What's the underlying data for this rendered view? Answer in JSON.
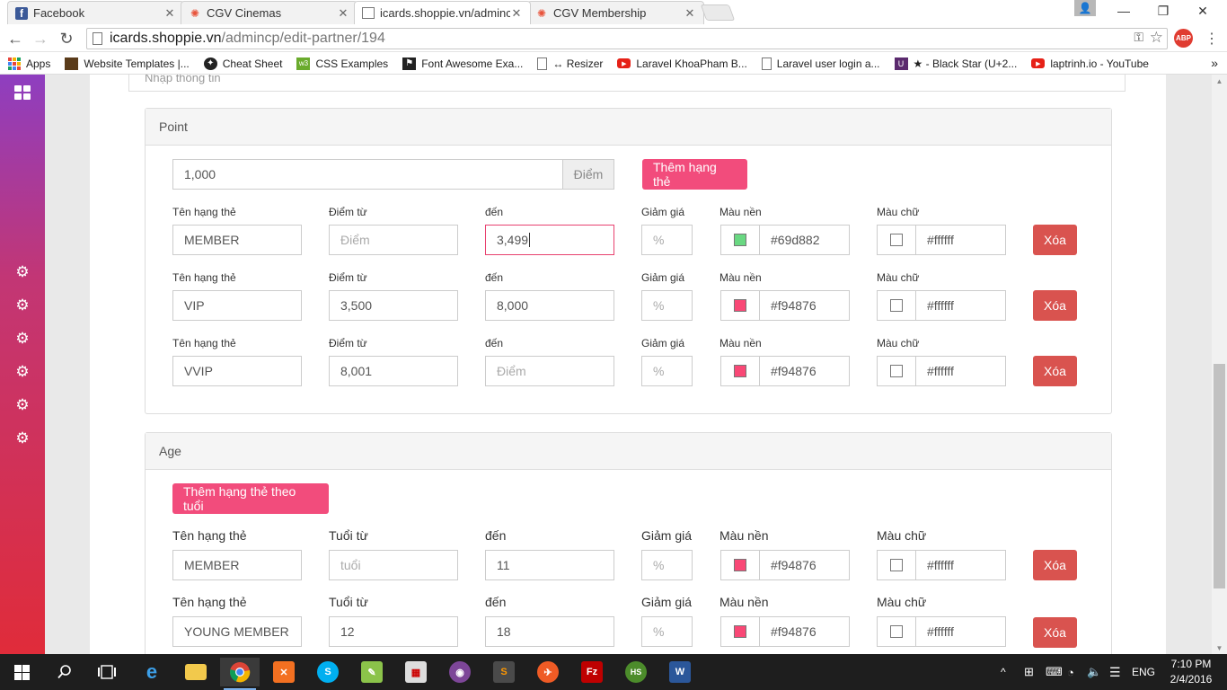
{
  "browser": {
    "tabs": [
      {
        "title": "Facebook",
        "icon": "facebook-icon"
      },
      {
        "title": "CGV Cinemas",
        "icon": "cgv-icon"
      },
      {
        "title": "icards.shoppie.vn/admincp",
        "icon": "page-icon"
      },
      {
        "title": "CGV Membership",
        "icon": "cgv-icon"
      }
    ],
    "url_host": "icards.shoppie.vn",
    "url_path": "/admincp/edit-partner/194",
    "abp_label": "ABP",
    "bookmarks": [
      {
        "label": "Apps",
        "icon": "apps-grid-icon",
        "color": "#e8453c"
      },
      {
        "label": "Website Templates |...",
        "icon": "bookmark-template-icon",
        "color": "#5a3b1a"
      },
      {
        "label": "Cheat Sheet",
        "icon": "bookmark-cheatsheet-icon",
        "color": "#222222"
      },
      {
        "label": "CSS Examples",
        "icon": "bookmark-w3-icon",
        "color": "#6aab2d"
      },
      {
        "label": "Font Awesome Exa...",
        "icon": "bookmark-flag-icon",
        "color": "#222222"
      },
      {
        "label": "↔ Resizer",
        "icon": "bookmark-page-icon",
        "color": "#ffffff"
      },
      {
        "label": "Laravel KhoaPham B...",
        "icon": "youtube-icon",
        "color": "#e62117"
      },
      {
        "label": "Laravel user login a...",
        "icon": "bookmark-page-icon",
        "color": "#ffffff"
      },
      {
        "label": "★ - Black Star (U+2...",
        "icon": "bookmark-unicode-icon",
        "color": "#5b2a6e"
      },
      {
        "label": "laptrinh.io - YouTube",
        "icon": "youtube-icon",
        "color": "#e62117"
      }
    ]
  },
  "page": {
    "top_label": "Nhập thông tin",
    "point_panel": {
      "heading": "Point",
      "points_value": "1,000",
      "points_addon": "Điểm",
      "add_button": "Thêm hạng thẻ",
      "labels": {
        "name": "Tên hạng thẻ",
        "from": "Điểm từ",
        "to": "đến",
        "discount": "Giảm giá",
        "bg_color": "Màu nền",
        "text_color": "Màu chữ"
      },
      "rows": [
        {
          "name": "MEMBER",
          "from": "",
          "from_placeholder": "Điểm",
          "to": "3,499",
          "discount_placeholder": "%",
          "bg_hex": "#69d882",
          "text_hex": "#ffffff",
          "delete": "Xóa"
        },
        {
          "name": "VIP",
          "from": "3,500",
          "from_placeholder": "Điểm",
          "to": "8,000",
          "discount_placeholder": "%",
          "bg_hex": "#f94876",
          "text_hex": "#ffffff",
          "delete": "Xóa"
        },
        {
          "name": "VVIP",
          "from": "8,001",
          "from_placeholder": "Điểm",
          "to": "",
          "to_placeholder": "Điểm",
          "discount_placeholder": "%",
          "bg_hex": "#f94876",
          "text_hex": "#ffffff",
          "delete": "Xóa"
        }
      ]
    },
    "age_panel": {
      "heading": "Age",
      "add_button": "Thêm hạng thẻ theo tuổi",
      "labels": {
        "name": "Tên hạng thẻ",
        "from": "Tuổi từ",
        "to": "đến",
        "discount": "Giảm giá",
        "bg_color": "Màu nền",
        "text_color": "Màu chữ"
      },
      "rows": [
        {
          "name": "MEMBER",
          "from": "",
          "from_placeholder": "tuổi",
          "to": "11",
          "discount_placeholder": "%",
          "bg_hex": "#f94876",
          "text_hex": "#ffffff",
          "delete": "Xóa"
        },
        {
          "name": "YOUNG MEMBER",
          "from": "12",
          "to": "18",
          "discount_placeholder": "%",
          "bg_hex": "#f94876",
          "text_hex": "#ffffff",
          "delete": "Xóa"
        }
      ]
    }
  },
  "taskbar": {
    "lang": "ENG",
    "time": "7:10 PM",
    "date": "2/4/2016"
  }
}
